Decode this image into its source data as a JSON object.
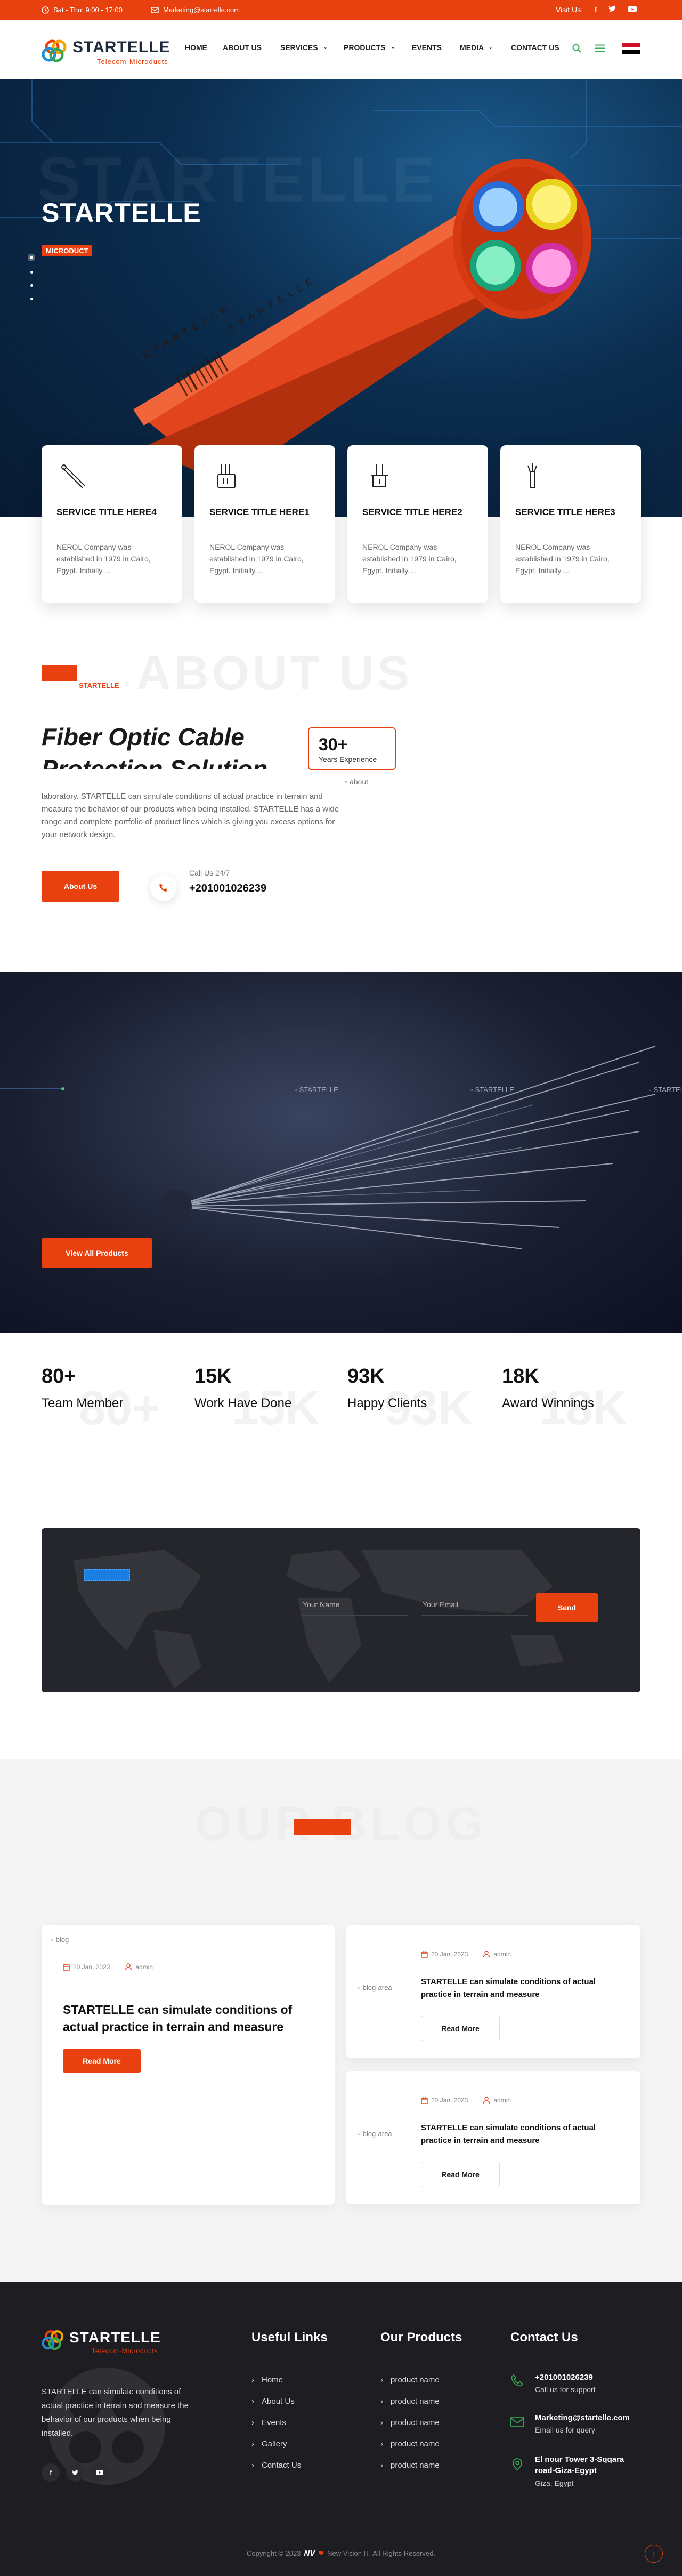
{
  "colors": {
    "accent": "#e8410f",
    "dark": "#1e1e22",
    "hero": "#0b2d4f"
  },
  "topbar": {
    "hours": "Sat - Thu: 9:00 - 17:00",
    "email": "Marketing@startelle.com",
    "visit_label": "Visit Us:",
    "socials": [
      "facebook-icon",
      "twitter-icon",
      "youtube-icon"
    ]
  },
  "logo": {
    "name": "STARTELLE",
    "tagline": "Telecom-Microducts"
  },
  "nav": {
    "items": [
      "HOME",
      "ABOUT US",
      "SERVICES",
      "PRODUCTS",
      "EVENTS",
      "MEDIA",
      "CONTACT US"
    ]
  },
  "hero": {
    "title": "STARTELLE",
    "badge": "MICRODUCT",
    "watermark": "STARTELLE",
    "cable_text_1": "S T A R T E L L E",
    "cable_text_2": "S T A R T E L L E"
  },
  "services": [
    {
      "title": "SERVICE TITLE HERE4",
      "desc": "NEROL Company was established in 1979 in Cairo, Egypt. Initially,..."
    },
    {
      "title": "SERVICE TITLE HERE1",
      "desc": "NEROL Company was established in 1979 in Cairo, Egypt. Initially,..."
    },
    {
      "title": "SERVICE TITLE HERE2",
      "desc": "NEROL Company was established in 1979 in Cairo, Egypt. Initially,..."
    },
    {
      "title": "SERVICE TITLE HERE3",
      "desc": "NEROL Company was established in 1979 in Cairo, Egypt. Initially,..."
    }
  ],
  "about": {
    "label": "STARTELLE",
    "watermark": "ABOUT US",
    "heading_1": "Fiber Optic Cable",
    "heading_2": "Protection Solution",
    "exp_num": "30+",
    "exp_label": "Years Experience",
    "img_alt": "about",
    "text": "laboratory. STARTELLE can simulate conditions of actual practice in terrain and measure the behavior of our products when being installed. STARTELLE has a wide range and complete portfolio of product lines which is giving you excess options for your network design.",
    "button": "About Us",
    "call_label": "Call Us 24/7",
    "phone": "+201001026239"
  },
  "products": {
    "img_alts": [
      "STARTELLE",
      "STARTELLE",
      "STARTELLE"
    ],
    "button": "View All Products"
  },
  "stats": [
    {
      "num": "80+",
      "label": "Team Member",
      "ghost": "80+"
    },
    {
      "num": "15K",
      "label": "Work Have Done",
      "ghost": "15K"
    },
    {
      "num": "93K",
      "label": "Happy Clients",
      "ghost": "93K"
    },
    {
      "num": "18K",
      "label": "Award Winnings",
      "ghost": "18K"
    }
  ],
  "contact": {
    "name_placeholder": "Your Name",
    "email_placeholder": "Your Email",
    "button": "Send"
  },
  "blog": {
    "watermark": "OUR BLOG",
    "main": {
      "img_alt": "blog",
      "date": "20 Jan, 2023",
      "author": "admin",
      "title": "STARTELLE can simulate conditions of actual practice in terrain and measure",
      "button": "Read More"
    },
    "side": [
      {
        "img_alt": "blog-area",
        "date": "20 Jan, 2023",
        "author": "admin",
        "title": "STARTELLE can simulate conditions of actual practice in terrain and measure",
        "button": "Read More"
      },
      {
        "img_alt": "blog-area",
        "date": "20 Jan, 2023",
        "author": "admin",
        "title": "STARTELLE can simulate conditions of actual practice in terrain and measure",
        "button": "Read More"
      }
    ]
  },
  "footer": {
    "about": "STARTELLE can simulate conditions of actual practice in terrain and measure the behavior of our products when being installed.",
    "useful_title": "Useful Links",
    "useful": [
      "Home",
      "About Us",
      "Events",
      "Gallery",
      "Contact Us"
    ],
    "products_title": "Our Products",
    "products": [
      "product name",
      "product name",
      "product name",
      "product name",
      "product name"
    ],
    "contact_title": "Contact Us",
    "contact": [
      {
        "main": "+201001026239",
        "sub": "Call us for support"
      },
      {
        "main": "Marketing@startelle.com",
        "sub": "Email us for query"
      },
      {
        "main": "El nour Tower 3-Sqqara road-Giza-Egypt",
        "sub": "Giza, Egypt"
      }
    ],
    "copyright_pre": "Copyright © 2023",
    "copyright_brand": "New Vision IT. All Rights Reserved."
  }
}
